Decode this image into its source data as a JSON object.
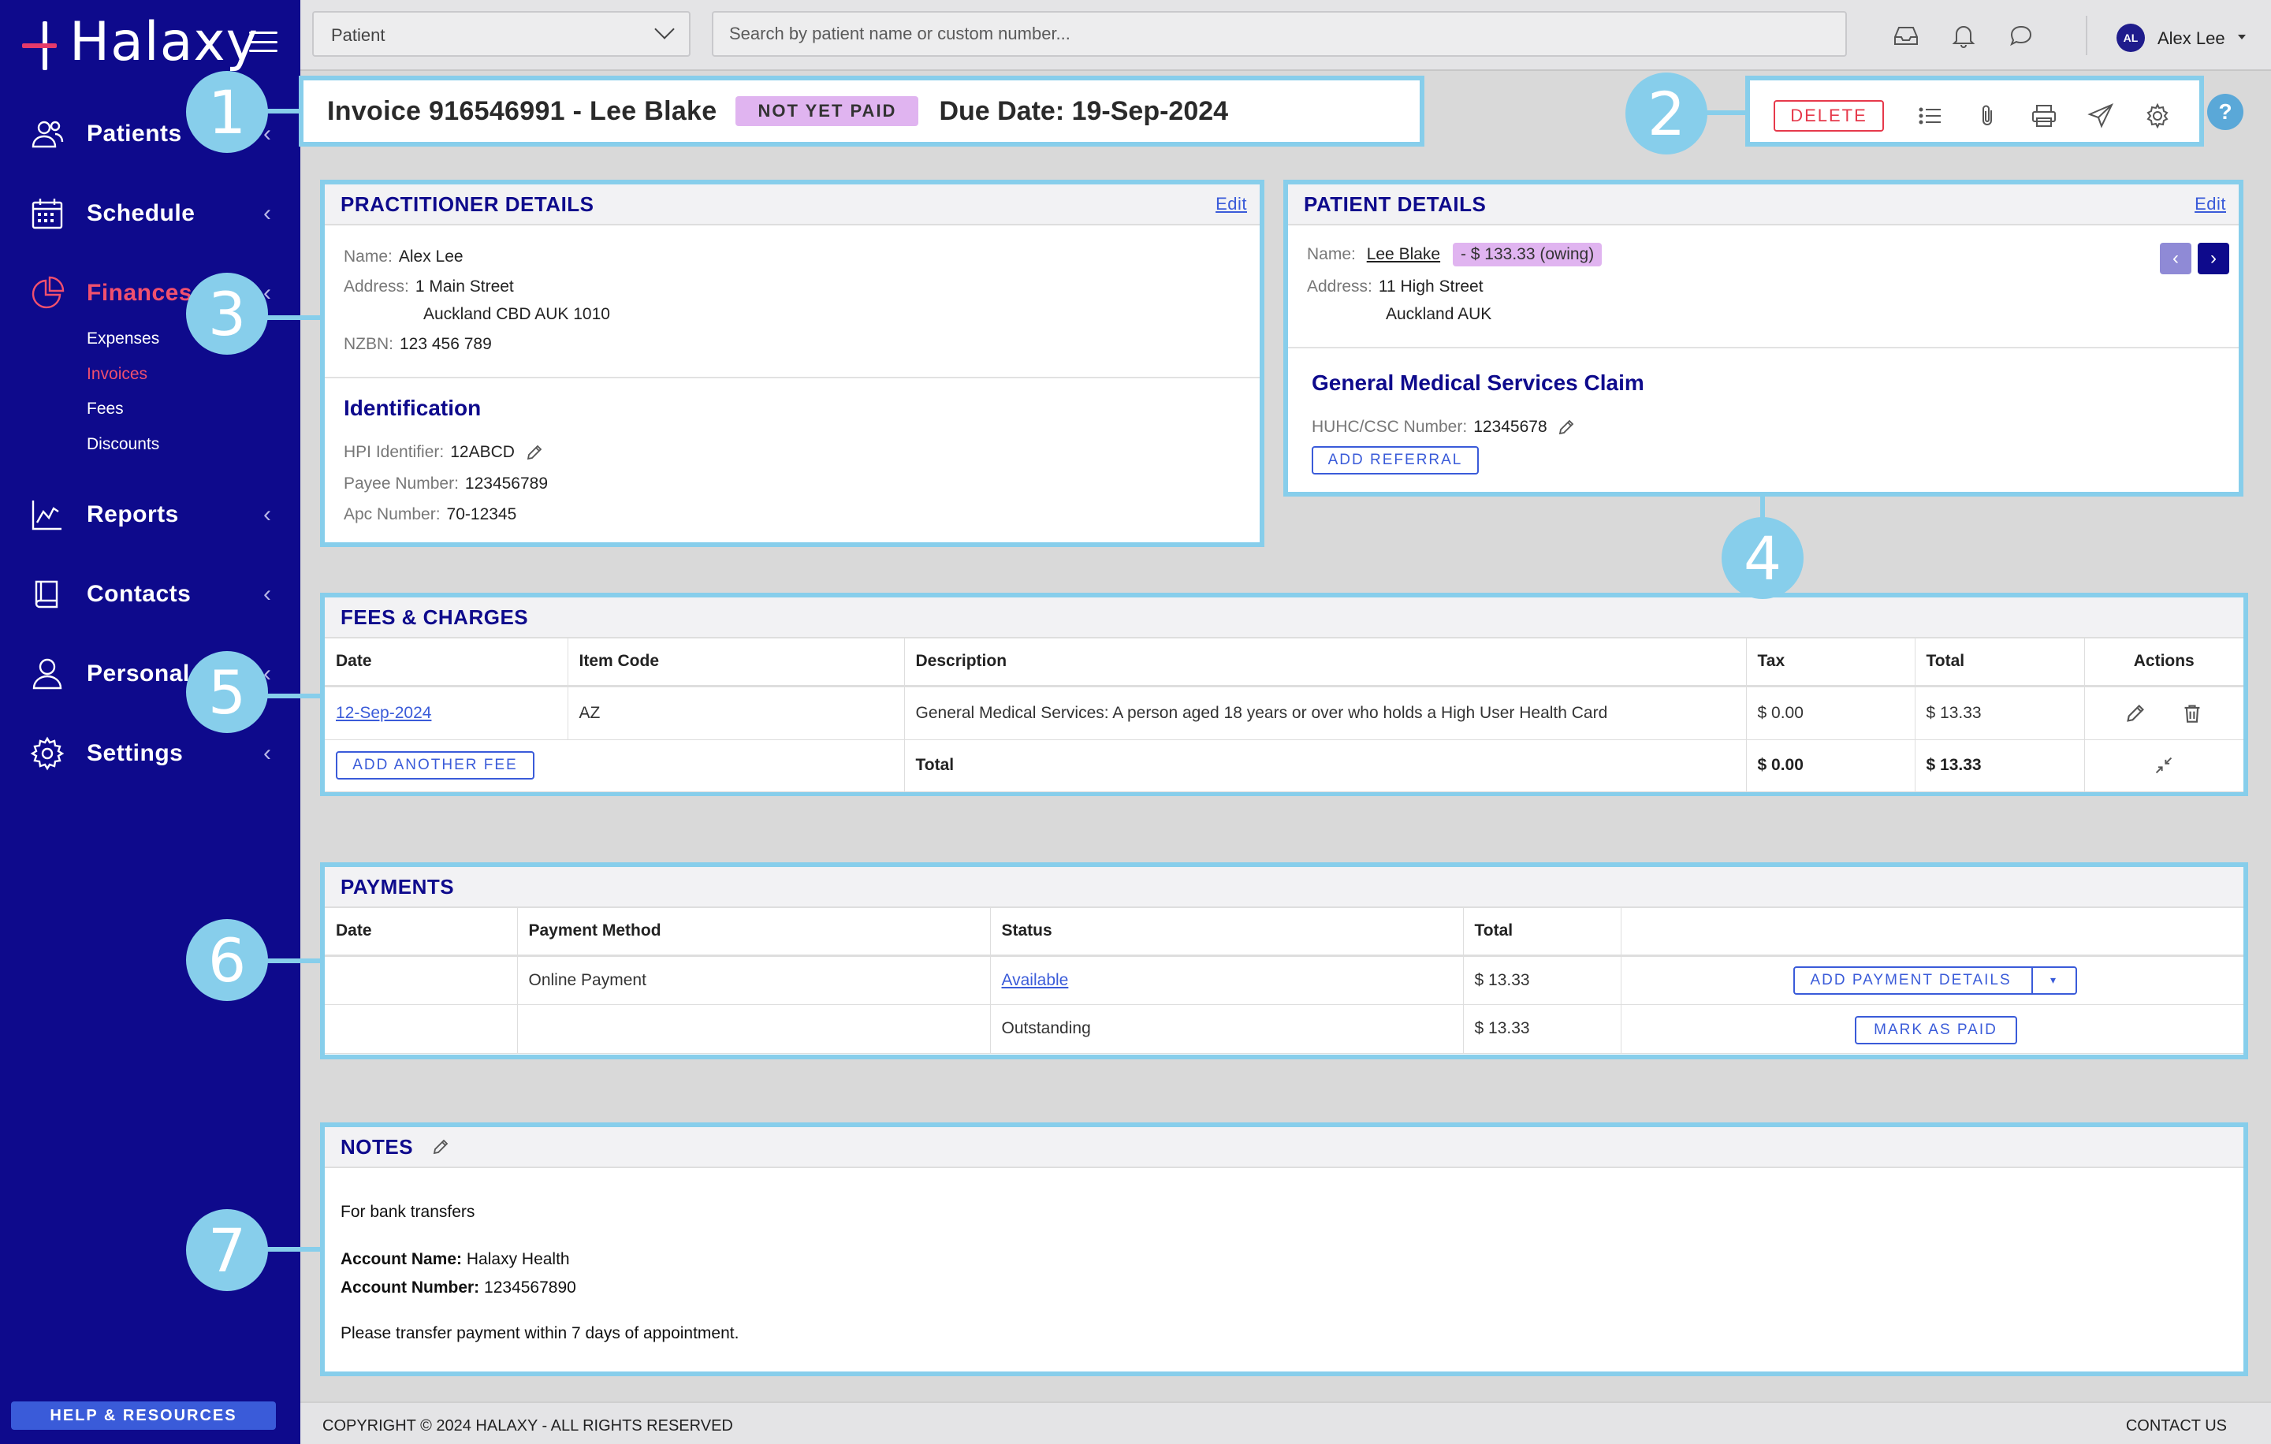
{
  "app": {
    "logo_text": "Halaxy"
  },
  "sidebar": {
    "items": [
      {
        "label": "Patients",
        "icon": "patients-icon"
      },
      {
        "label": "Schedule",
        "icon": "calendar-icon"
      },
      {
        "label": "Finances",
        "icon": "pie-chart-icon",
        "active": true
      },
      {
        "label": "Reports",
        "icon": "line-chart-icon"
      },
      {
        "label": "Contacts",
        "icon": "book-icon"
      },
      {
        "label": "Personal",
        "icon": "user-icon"
      },
      {
        "label": "Settings",
        "icon": "gear-icon"
      }
    ],
    "finance_sub": [
      "Expenses",
      "Invoices",
      "Fees",
      "Discounts"
    ],
    "help_label": "HELP & RESOURCES"
  },
  "topbar": {
    "patient_select": "Patient",
    "search_placeholder": "Search by patient name or custom number...",
    "user_initials": "AL",
    "user_name": "Alex Lee"
  },
  "invoice": {
    "title": "Invoice 916546991 - Lee Blake",
    "status": "NOT YET PAID",
    "due_date": "Due Date: 19-Sep-2024",
    "delete_label": "DELETE",
    "help": "?"
  },
  "callouts": [
    "1",
    "2",
    "3",
    "4",
    "5",
    "6",
    "7"
  ],
  "practitioner": {
    "heading": "PRACTITIONER DETAILS",
    "edit": "Edit",
    "name_label": "Name:",
    "name": "Alex Lee",
    "address_label": "Address:",
    "address1": "1 Main Street",
    "address2": "Auckland CBD AUK 1010",
    "nzbn_label": "NZBN:",
    "nzbn": "123 456 789",
    "id_heading": "Identification",
    "hpi_label": "HPI Identifier:",
    "hpi": "12ABCD",
    "payee_label": "Payee Number:",
    "payee": "123456789",
    "apc_label": "Apc Number:",
    "apc": "70-12345"
  },
  "patient": {
    "heading": "PATIENT DETAILS",
    "edit": "Edit",
    "name_label": "Name:",
    "name": "Lee Blake",
    "owing": "- $ 133.33 (owing)",
    "address_label": "Address:",
    "address1": "11 High Street",
    "address2": "Auckland AUK",
    "claim_heading": "General Medical Services Claim",
    "huhc_label": "HUHC/CSC Number:",
    "huhc": "12345678",
    "add_referral": "ADD REFERRAL",
    "prev": "‹",
    "next": "›"
  },
  "fees": {
    "heading": "FEES & CHARGES",
    "columns": [
      "Date",
      "Item Code",
      "Description",
      "Tax",
      "Total",
      "Actions"
    ],
    "row": {
      "date": "12-Sep-2024",
      "item_code": "AZ",
      "description": "General Medical Services: A person aged 18 years or over who holds a High User Health Card",
      "tax": "$ 0.00",
      "total": "$ 13.33"
    },
    "add_fee": "ADD ANOTHER FEE",
    "total_label": "Total",
    "total_tax": "$ 0.00",
    "total_total": "$ 13.33"
  },
  "payments": {
    "heading": "PAYMENTS",
    "columns": [
      "Date",
      "Payment Method",
      "Status",
      "Total",
      ""
    ],
    "rows": [
      {
        "date": "",
        "method": "Online Payment",
        "status": "Available",
        "total": "$ 13.33",
        "action": "ADD PAYMENT DETAILS"
      },
      {
        "date": "",
        "method": "",
        "status": "Outstanding",
        "total": "$ 13.33",
        "action": "MARK AS PAID"
      }
    ]
  },
  "notes": {
    "heading": "NOTES",
    "line1": "For bank transfers",
    "acc_name_label": "Account Name:",
    "acc_name": "Halaxy Health",
    "acc_num_label": "Account Number:",
    "acc_num": "1234567890",
    "line4": "Please transfer payment within 7 days of appointment."
  },
  "footer": {
    "copyright": "COPYRIGHT © 2024 HALAXY - ALL RIGHTS RESERVED",
    "contact": "CONTACT US"
  },
  "colors": {
    "sidebar": "#0e0a8c",
    "accent": "#f0506e",
    "callout": "#87ceeb",
    "status_badge": "#e0b4f0",
    "link": "#3a5bd9"
  }
}
